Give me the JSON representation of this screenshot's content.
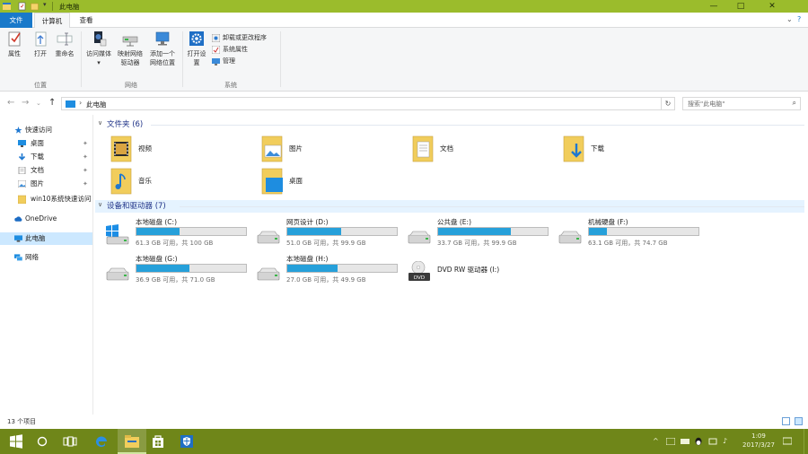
{
  "window": {
    "title": "此电脑",
    "minimize": "—",
    "maximize": "□",
    "close": "✕"
  },
  "ribbon_tabs": [
    "文件",
    "计算机",
    "查看"
  ],
  "ribbon": {
    "groups": [
      {
        "label": "位置",
        "buttons": [
          "属性",
          "打开",
          "重命名"
        ]
      },
      {
        "label": "网络",
        "buttons": [
          "访问媒体",
          "映射网络驱动器",
          "添加一个网络位置"
        ]
      },
      {
        "label": "系统",
        "buttons": [
          "打开设置"
        ],
        "small": [
          "卸载或更改程序",
          "系统属性",
          "管理"
        ]
      }
    ]
  },
  "address": {
    "path": "此电脑",
    "back": "←",
    "forward": "→",
    "up": "↑",
    "dropdown": "⌄",
    "refresh": "↻"
  },
  "search": {
    "placeholder": "搜索\"此电脑\"",
    "icon": "search-icon",
    "glyph": "⌕"
  },
  "nav": {
    "items": [
      {
        "label": "快速访问",
        "icon": "star-icon",
        "pinned": false
      },
      {
        "label": "桌面",
        "icon": "desktop-icon",
        "pinned": true
      },
      {
        "label": "下载",
        "icon": "download-icon",
        "pinned": true
      },
      {
        "label": "文档",
        "icon": "documents-icon",
        "pinned": true
      },
      {
        "label": "图片",
        "icon": "pictures-icon",
        "pinned": true
      },
      {
        "label": "win10系统快速访问",
        "icon": "folder-icon",
        "pinned": false
      },
      {
        "label": "OneDrive",
        "icon": "cloud-icon",
        "pinned": false
      },
      {
        "label": "此电脑",
        "icon": "computer-icon",
        "pinned": false
      },
      {
        "label": "网络",
        "icon": "network-icon",
        "pinned": false
      }
    ],
    "pin_glyph": "📌"
  },
  "sections": {
    "folders": {
      "title": "文件夹 (6)",
      "chevron": "∨"
    },
    "drives": {
      "title": "设备和驱动器 (7)",
      "chevron": "∨"
    }
  },
  "folders": [
    {
      "name": "视频",
      "icon": "video-folder-icon"
    },
    {
      "name": "图片",
      "icon": "pictures-folder-icon"
    },
    {
      "name": "文档",
      "icon": "documents-folder-icon"
    },
    {
      "name": "下载",
      "icon": "downloads-folder-icon"
    },
    {
      "name": "音乐",
      "icon": "music-folder-icon"
    },
    {
      "name": "桌面",
      "icon": "desktop-folder-icon"
    }
  ],
  "drives": [
    {
      "name": "本地磁盘 (C:)",
      "info": "61.3 GB 可用，共 100 GB",
      "used_fraction": 0.39,
      "icon": "windows-drive-icon"
    },
    {
      "name": "网页设计 (D:)",
      "info": "51.0 GB 可用，共 99.9 GB",
      "used_fraction": 0.49,
      "icon": "hard-drive-icon"
    },
    {
      "name": "公共盘 (E:)",
      "info": "33.7 GB 可用，共 99.9 GB",
      "used_fraction": 0.66,
      "icon": "hard-drive-icon"
    },
    {
      "name": "机械硬盘 (F:)",
      "info": "63.1 GB 可用，共 74.7 GB",
      "used_fraction": 0.16,
      "icon": "hard-drive-icon"
    },
    {
      "name": "本地磁盘 (G:)",
      "info": "36.9 GB 可用，共 71.0 GB",
      "used_fraction": 0.48,
      "icon": "hard-drive-icon"
    },
    {
      "name": "本地磁盘 (H:)",
      "info": "27.0 GB 可用，共 49.9 GB",
      "used_fraction": 0.46,
      "icon": "hard-drive-icon"
    },
    {
      "name": "DVD RW 驱动器 (I:)",
      "info": "",
      "used_fraction": null,
      "icon": "dvd-drive-icon"
    }
  ],
  "status": {
    "count": "13 个项目"
  },
  "taskbar": {
    "clock_time": "1:09",
    "clock_date": "2017/3/27",
    "tray_text": [
      "^",
      "⌨",
      "♪",
      "中"
    ]
  },
  "colors": {
    "titlebar": "#9bbc2c",
    "taskbar": "#6f8619",
    "accent": "#1979ca",
    "drive_fill": "#26a0da",
    "selection": "#cce8ff"
  }
}
